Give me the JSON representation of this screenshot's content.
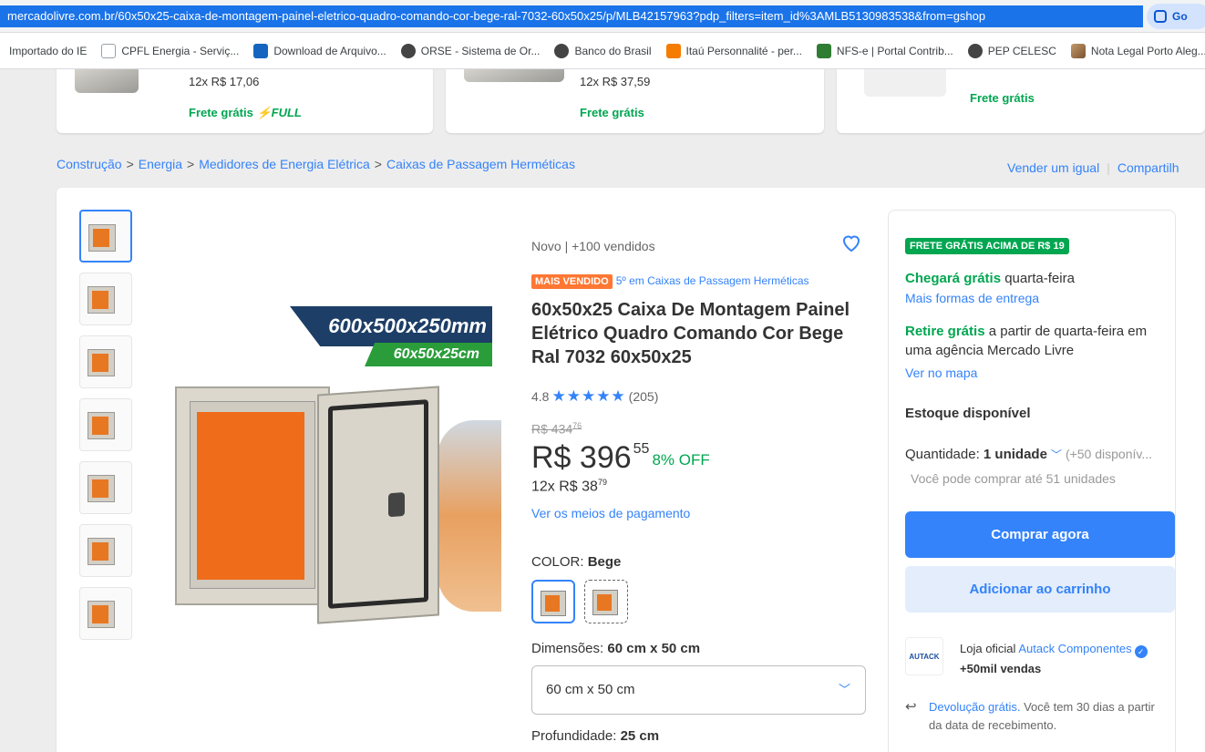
{
  "browser": {
    "url": "mercadolivre.com.br/60x50x25-caixa-de-montagem-painel-eletrico-quadro-comando-cor-bege-ral-7032-60x50x25/p/MLB42157963?pdp_filters=item_id%3AMLB5130983538&from=gshop",
    "lens_label": "Go"
  },
  "bookmarks": [
    {
      "label": "Importado do IE",
      "icon": "none"
    },
    {
      "label": "CPFL Energia - Serviç...",
      "icon": "doc-icon"
    },
    {
      "label": "Download de Arquivo...",
      "icon": "download-icon"
    },
    {
      "label": "ORSE - Sistema de Or...",
      "icon": "globe-icon"
    },
    {
      "label": "Banco do Brasil",
      "icon": "globe-icon"
    },
    {
      "label": "Itaú Personnalité - per...",
      "icon": "itau-icon"
    },
    {
      "label": "NFS-e | Portal Contrib...",
      "icon": "nfse-icon"
    },
    {
      "label": "PEP CELESC",
      "icon": "globe-icon"
    },
    {
      "label": "Nota Legal Porto Aleg...",
      "icon": "picture-icon"
    }
  ],
  "top_cards": [
    {
      "installment": "12x R$ 17,06",
      "shipping": "Frete grátis",
      "full": "FULL"
    },
    {
      "installment": "12x R$ 37,59",
      "shipping": "Frete grátis"
    },
    {
      "shipping": "Frete grátis"
    }
  ],
  "breadcrumb": [
    "Construção",
    "Energia",
    "Medidores de Energia Elétrica",
    "Caixas de Passagem Herméticas"
  ],
  "breadcrumb_actions": {
    "sell": "Vender um igual",
    "share": "Compartilh"
  },
  "gallery": {
    "thumbnail_count": 7,
    "banner_main": "600x500x250mm",
    "banner_sub": "60x50x25cm"
  },
  "product": {
    "condition": "Novo  |  +100 vendidos",
    "badge": "MAIS VENDIDO",
    "rank": "5º em Caixas de Passagem Herméticas",
    "title": "60x50x25 Caixa De Montagem Painel Elétrico Quadro Comando Cor Bege Ral 7032 60x50x25",
    "rating_value": "4.8",
    "stars": "★★★★★",
    "rating_count": "(205)",
    "old_price": "R$ 434",
    "old_price_cents": "76",
    "price": "R$ 396",
    "price_cents": "55",
    "discount": "8% OFF",
    "installments": "12x R$ 38",
    "installments_cents": "79",
    "payment_link": "Ver os meios de pagamento",
    "color_label": "COLOR: ",
    "color_value": "Bege",
    "dimension_label": "Dimensões: ",
    "dimension_value": "60 cm x 50 cm",
    "dimension_select": "60 cm x 50 cm",
    "depth_label": "Profundidade: ",
    "depth_value": "25 cm"
  },
  "buybox": {
    "free_badge": "FRETE GRÁTIS ACIMA DE R$ 19",
    "arrival_strong": "Chegará grátis",
    "arrival_rest": " quarta-feira",
    "more_delivery": "Mais formas de entrega",
    "pickup_strong": "Retire grátis",
    "pickup_rest": " a partir de quarta-feira em uma agência Mercado Livre",
    "map_link": "Ver no mapa",
    "stock": "Estoque disponível",
    "qty_label": "Quantidade: ",
    "qty_value": "1 unidade",
    "qty_avail": "(+50 disponív...",
    "max_buy": "Você pode comprar até 51 unidades",
    "buy_now": "Comprar agora",
    "add_cart": "Adicionar ao carrinho",
    "seller_logo": "AUTACK",
    "seller_prefix": "Loja oficial ",
    "seller_name": "Autack Componentes",
    "seller_sales": "+50mil vendas",
    "return_link": "Devolução grátis.",
    "return_rest": " Você tem 30 dias a partir da data de recebimento."
  },
  "colors": {
    "accent": "#3483fa",
    "success": "#00a650",
    "badge": "#ff7733"
  }
}
